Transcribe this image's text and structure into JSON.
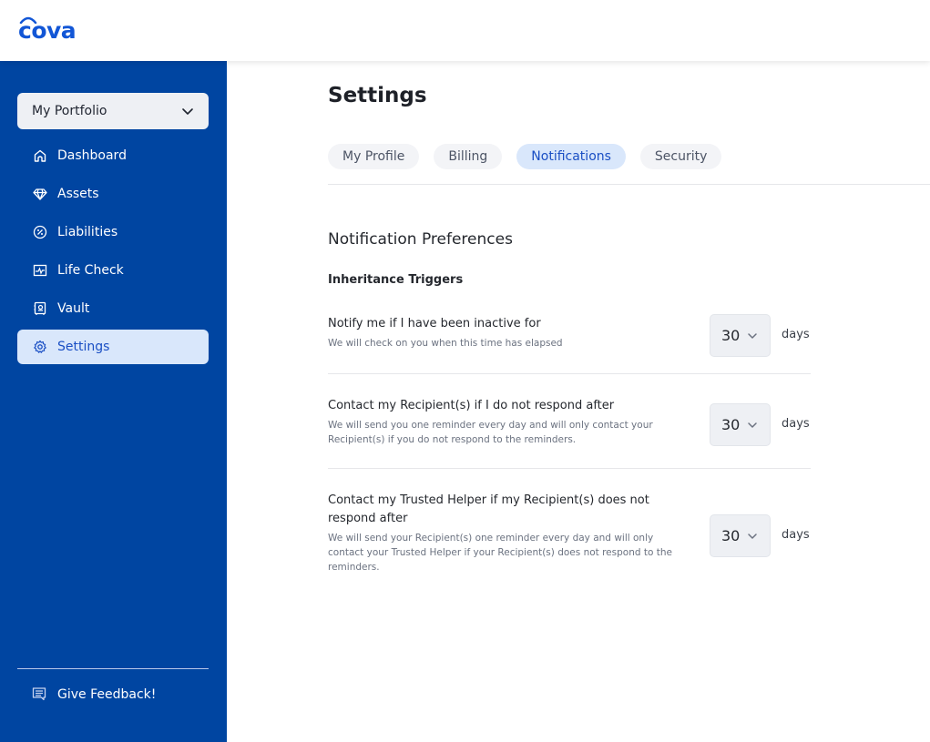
{
  "app": {
    "logo": "cova",
    "brand_color": "#1256d6",
    "sidebar_color": "#0045a1"
  },
  "sidebar": {
    "portfolio_selector": {
      "value": "My Portfolio",
      "icon": "chevron-down-icon"
    },
    "items": [
      {
        "label": "Dashboard",
        "icon": "home-icon",
        "active": false
      },
      {
        "label": "Assets",
        "icon": "diamond-icon",
        "active": false
      },
      {
        "label": "Liabilities",
        "icon": "percent-icon",
        "active": false
      },
      {
        "label": "Life Check",
        "icon": "heartbeat-icon",
        "active": false
      },
      {
        "label": "Vault",
        "icon": "vault-icon",
        "active": false
      },
      {
        "label": "Settings",
        "icon": "gear-icon",
        "active": true
      }
    ],
    "feedback": {
      "label": "Give Feedback!",
      "icon": "message-icon"
    }
  },
  "main": {
    "title": "Settings",
    "tabs": [
      {
        "label": "My Profile",
        "active": false
      },
      {
        "label": "Billing",
        "active": false
      },
      {
        "label": "Notifications",
        "active": true
      },
      {
        "label": "Security",
        "active": false
      }
    ],
    "section_title": "Notification Preferences",
    "subsection_title": "Inheritance Triggers",
    "preferences": [
      {
        "question": "Notify me if I have been inactive for",
        "description": "We will check on you when this time has elapsed",
        "value": "30",
        "unit": "days"
      },
      {
        "question": "Contact my Recipient(s) if I do not respond after",
        "description": "We will send you one reminder every day and will only contact your Recipient(s) if you do not respond to the reminders.",
        "value": "30",
        "unit": "days"
      },
      {
        "question": "Contact my Trusted Helper if my Recipient(s) does not respond after",
        "description": "We will send your Recipient(s) one reminder every day and will only contact your Trusted Helper if your Recipient(s) does not respond to the reminders.",
        "value": "30",
        "unit": "days"
      }
    ]
  }
}
